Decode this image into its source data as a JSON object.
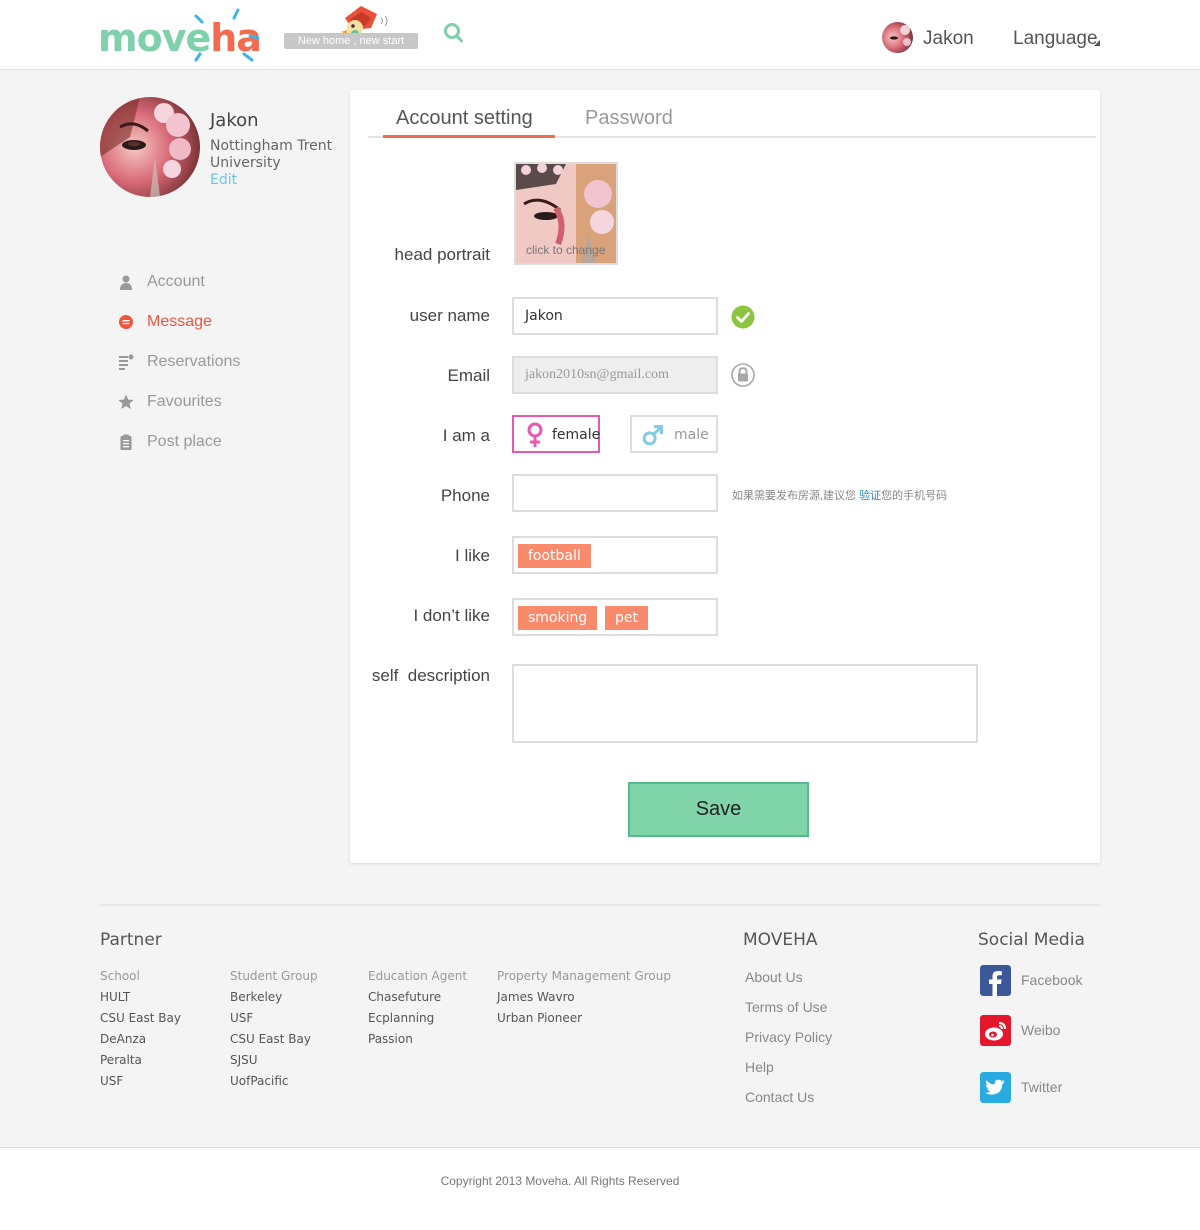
{
  "header": {
    "logo_move": "move",
    "logo_ha": "ha",
    "slogan": "New home , new start",
    "user_name": "Jakon",
    "language": "Language"
  },
  "sidebar": {
    "name": "Jakon",
    "school": "Nottingham Trent University",
    "edit": "Edit",
    "items": [
      {
        "label": "Account",
        "icon": "person-icon"
      },
      {
        "label": "Message",
        "icon": "message-icon",
        "active": true
      },
      {
        "label": "Reservations",
        "icon": "list-icon"
      },
      {
        "label": "Favourites",
        "icon": "star-icon"
      },
      {
        "label": "Post place",
        "icon": "clipboard-icon"
      }
    ]
  },
  "tabs": {
    "account": "Account setting",
    "password": "Password"
  },
  "form": {
    "head_portrait_label": "head portrait",
    "portrait_caption": "click to change",
    "username_label": "user name",
    "username_value": "Jakon",
    "email_label": "Email",
    "email_value": "jakon2010sn@gmail.com",
    "gender_label": "I am a",
    "female": "female",
    "male": "male",
    "selected_gender": "female",
    "phone_label": "Phone",
    "phone_value": "",
    "phone_hint_before": "如果需要发布房源,建议您",
    "phone_hint_link": "验证",
    "phone_hint_after": "您的手机号码",
    "like_label": "I like",
    "likes": [
      "football"
    ],
    "dislike_label": "I don’t like",
    "dislikes": [
      "smoking",
      "pet"
    ],
    "self_desc_label": "self  description",
    "self_desc_value": "",
    "save": "Save"
  },
  "footer": {
    "partner_title": "Partner",
    "partner_columns": [
      {
        "heading": "School",
        "items": [
          "HULT",
          "CSU East Bay",
          "DeAnza",
          "Peralta",
          "USF"
        ]
      },
      {
        "heading": "Student Group",
        "items": [
          "Berkeley",
          "USF",
          "CSU East Bay",
          "SJSU",
          "UofPacific"
        ]
      },
      {
        "heading": "Education Agent",
        "items": [
          "Chasefuture",
          "Ecplanning",
          "Passion"
        ]
      },
      {
        "heading": "Property Management Group",
        "items": [
          "James Wavro",
          "Urban Pioneer"
        ]
      }
    ],
    "moveha_title": "MOVEHA",
    "moveha_links": [
      "About Us",
      "Terms of Use",
      "Privacy Policy",
      "Help",
      "Contact Us"
    ],
    "social_title": "Social Media",
    "social": [
      {
        "label": "Facebook",
        "icon": "facebook-icon",
        "color": "#3b5998"
      },
      {
        "label": "Weibo",
        "icon": "weibo-icon",
        "color": "#e6162d"
      },
      {
        "label": "Twitter",
        "icon": "twitter-icon",
        "color": "#29aae1"
      }
    ],
    "copyright": "Copyright 2013 Moveha.  All Rights Reserved"
  },
  "colors": {
    "accent_green": "#80d4aa",
    "accent_orange": "#f26b4f",
    "tag_orange": "#f98a6c",
    "female_pink": "#e858b2",
    "male_blue": "#7fcbe8"
  }
}
